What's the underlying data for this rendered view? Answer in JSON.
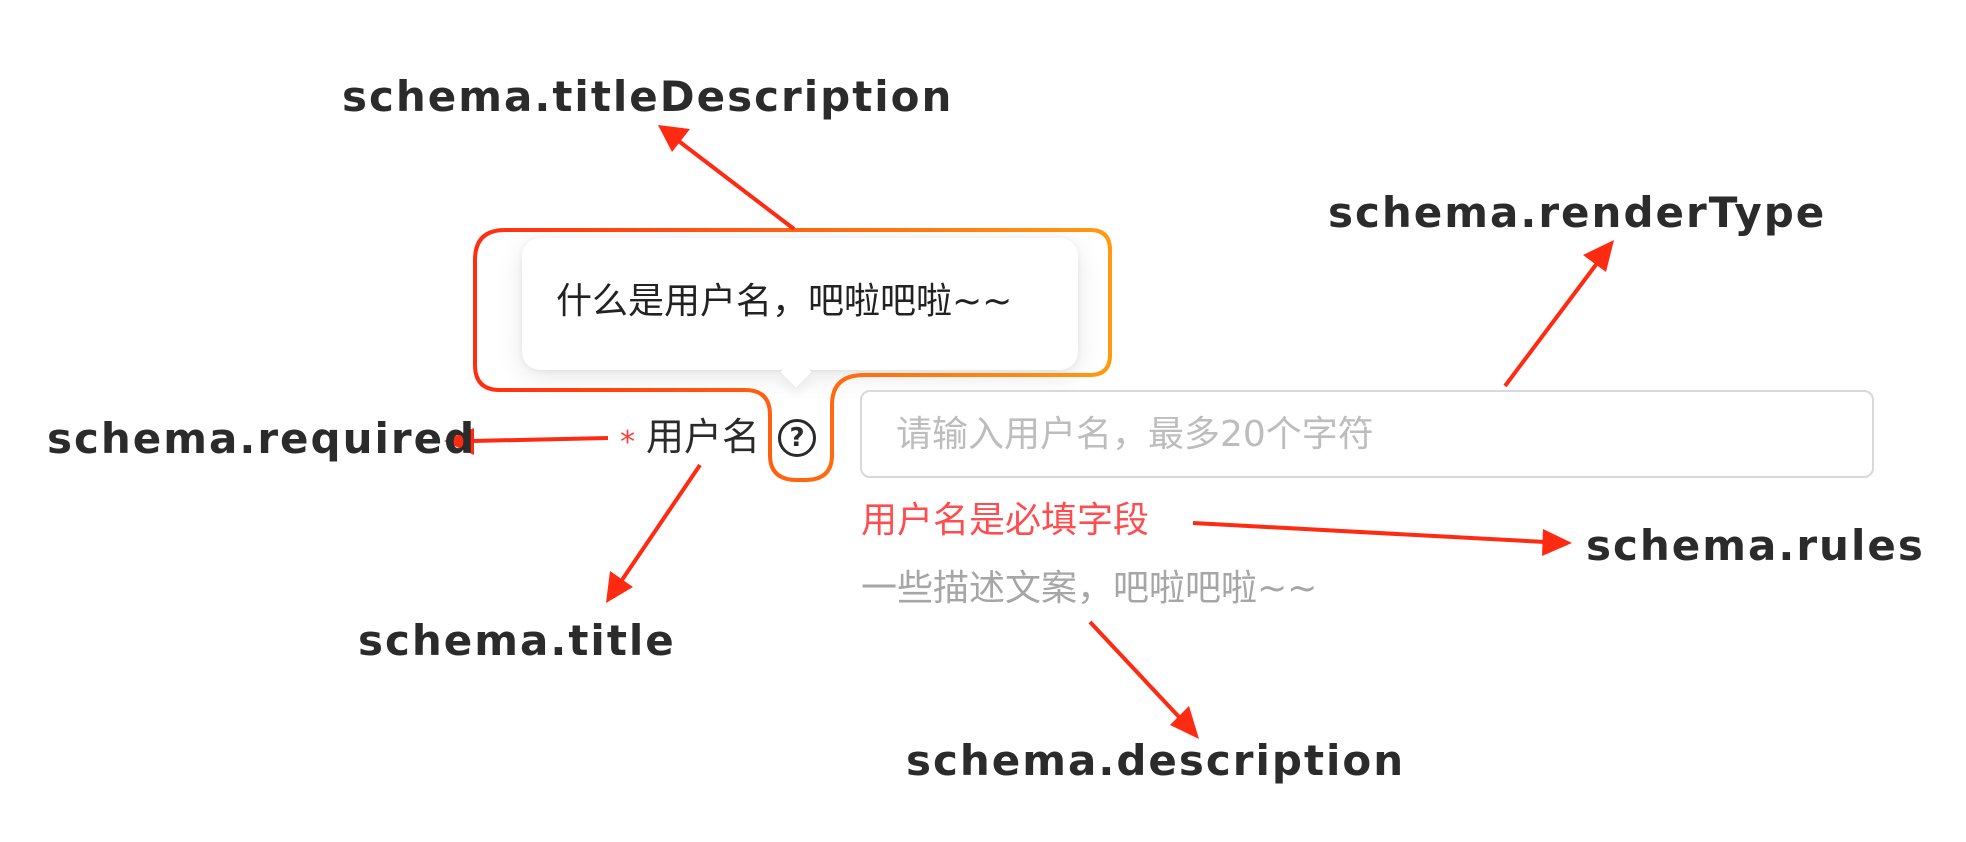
{
  "annotations": {
    "title_description": "schema.titleDescription",
    "render_type": "schema.renderType",
    "required": "schema.required",
    "title": "schema.title",
    "rules": "schema.rules",
    "description": "schema.description"
  },
  "tooltip": {
    "text": "什么是用户名，吧啦吧啦~~"
  },
  "field": {
    "required_mark": "*",
    "label": "用户名",
    "help_icon": "question-circle-icon",
    "placeholder": "请输入用户名，最多20个字符",
    "value": "",
    "error": "用户名是必填字段",
    "description": "一些描述文案，吧啦吧啦~~"
  },
  "colors": {
    "arrow": "#ff2a12",
    "outline_start": "#ff2d10",
    "outline_end": "#ff9a10",
    "error": "#ff4d4f",
    "description": "#a6a6a6"
  }
}
